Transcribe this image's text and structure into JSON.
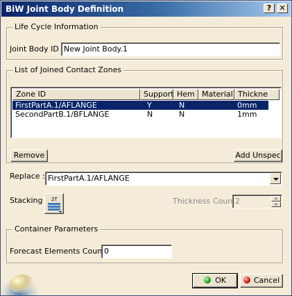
{
  "window": {
    "title": "BiW Joint Body Definition",
    "help_glyph": "?",
    "close_glyph": "✕"
  },
  "lifecycle": {
    "legend": "Life Cycle Information",
    "joint_body_label": "Joint Body ID :",
    "joint_body_value": "New Joint Body.1"
  },
  "zones": {
    "legend": "List of Joined Contact Zones",
    "columns": [
      "Zone ID",
      "Support",
      "Hem",
      "Material",
      "Thickness"
    ],
    "rows": [
      {
        "zone": "FirstPartA.1/AFLANGE",
        "support": "Y",
        "hem": "N",
        "material": "",
        "thickness": "0mm",
        "selected": true
      },
      {
        "zone": "SecondPartB.1/BFLANGE",
        "support": "N",
        "hem": "N",
        "material": "",
        "thickness": "1mm",
        "selected": false
      }
    ],
    "remove_label": "Remove",
    "add_unspec_label": "Add Unspec"
  },
  "replace": {
    "label": "Replace :",
    "value": "FirstPartA.1/AFLANGE"
  },
  "stacking": {
    "label": "Stacking :",
    "icon_text": "2T",
    "thickness_count_label": "Thickness Count:",
    "thickness_count_value": "2"
  },
  "container": {
    "legend": "Container Parameters",
    "forecast_label": "Forecast Elements Count :",
    "forecast_value": "0"
  },
  "footer": {
    "ok_label": "OK",
    "cancel_label": "Cancel",
    "ok_color": "#1aa31a",
    "cancel_color": "#d01818"
  }
}
